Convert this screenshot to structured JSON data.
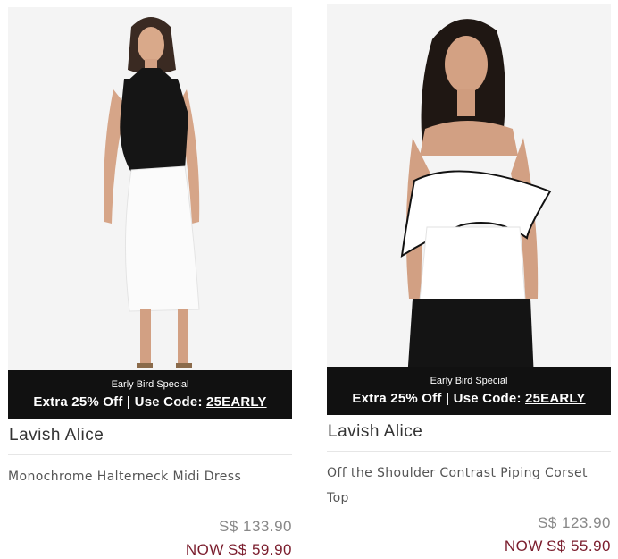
{
  "products": [
    {
      "brand": "Lavish Alice",
      "name": "Monochrome Halterneck Midi Dress",
      "price_old": "S$ 133.90",
      "price_now_label": "NOW",
      "price_now": "S$ 59.90",
      "banner": {
        "line1": "Early Bird Special",
        "offer": "Extra 25% Off | Use Code: ",
        "code": "25EARLY"
      }
    },
    {
      "brand": "Lavish Alice",
      "name": "Off the Shoulder Contrast Piping Corset Top",
      "price_old": "S$ 123.90",
      "price_now_label": "NOW",
      "price_now": "S$ 55.90",
      "banner": {
        "line1": "Early Bird Special",
        "offer": "Extra 25% Off | Use Code: ",
        "code": "25EARLY"
      }
    }
  ],
  "colors": {
    "banner_bg": "#111111",
    "sale_price": "#7a1c2c",
    "old_price": "#888888"
  }
}
